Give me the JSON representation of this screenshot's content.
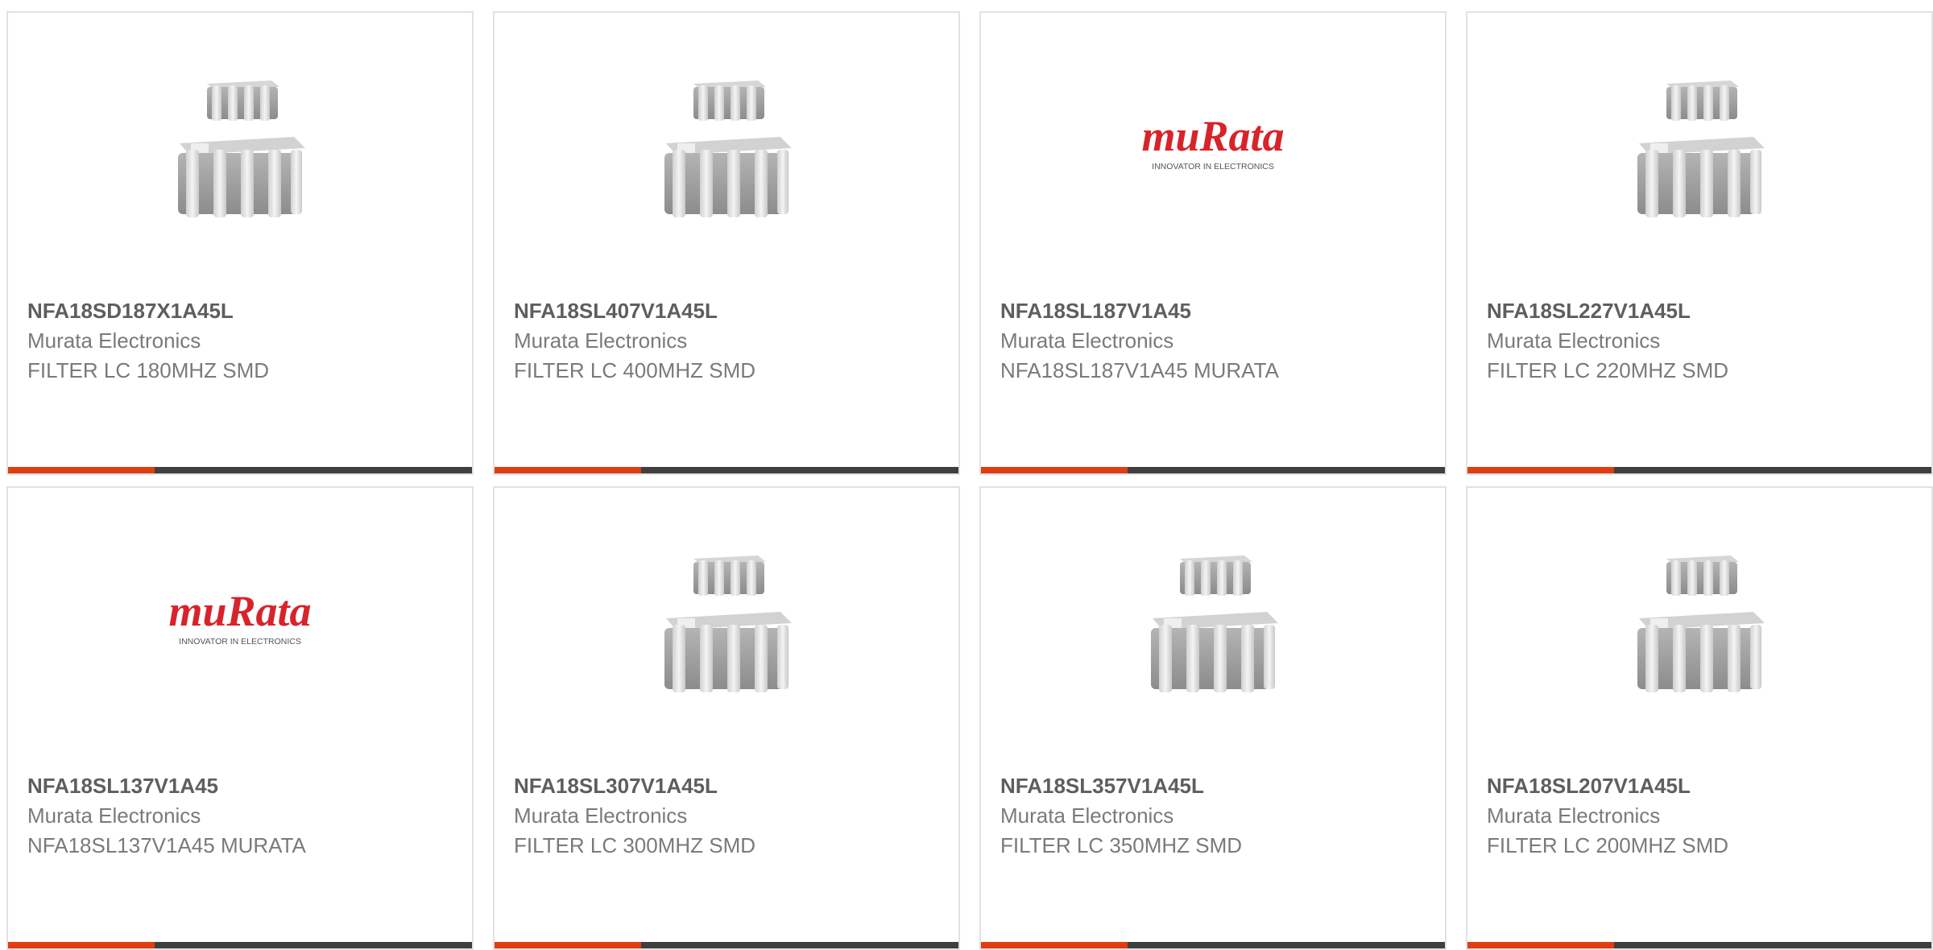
{
  "colors": {
    "accent": "#e03d12",
    "bar": "#3f3f3f",
    "border": "#e2e2e2",
    "part_number": "#5e5e5e",
    "secondary_text": "#7a7a7a",
    "murata_logo": "#d8232a"
  },
  "products": [
    {
      "part_number": "NFA18SD187X1A45L",
      "manufacturer": "Murata Electronics",
      "description": "FILTER LC 180MHZ SMD",
      "image": "lc-filter-chip-image"
    },
    {
      "part_number": "NFA18SL407V1A45L",
      "manufacturer": "Murata Electronics",
      "description": "FILTER LC 400MHZ SMD",
      "image": "lc-filter-chip-image"
    },
    {
      "part_number": "NFA18SL187V1A45",
      "manufacturer": "Murata Electronics",
      "description": "NFA18SL187V1A45 MURATA",
      "image": "murata-logo",
      "logo": {
        "wordmark": "muRata",
        "tagline": "INNOVATOR IN ELECTRONICS"
      }
    },
    {
      "part_number": "NFA18SL227V1A45L",
      "manufacturer": "Murata Electronics",
      "description": "FILTER LC 220MHZ SMD",
      "image": "lc-filter-chip-image"
    },
    {
      "part_number": "NFA18SL137V1A45",
      "manufacturer": "Murata Electronics",
      "description": "NFA18SL137V1A45 MURATA",
      "image": "murata-logo",
      "logo": {
        "wordmark": "muRata",
        "tagline": "INNOVATOR IN ELECTRONICS"
      }
    },
    {
      "part_number": "NFA18SL307V1A45L",
      "manufacturer": "Murata Electronics",
      "description": "FILTER LC 300MHZ SMD",
      "image": "lc-filter-chip-image"
    },
    {
      "part_number": "NFA18SL357V1A45L",
      "manufacturer": "Murata Electronics",
      "description": "FILTER LC 350MHZ SMD",
      "image": "lc-filter-chip-image"
    },
    {
      "part_number": "NFA18SL207V1A45L",
      "manufacturer": "Murata Electronics",
      "description": "FILTER LC 200MHZ SMD",
      "image": "lc-filter-chip-image"
    }
  ]
}
